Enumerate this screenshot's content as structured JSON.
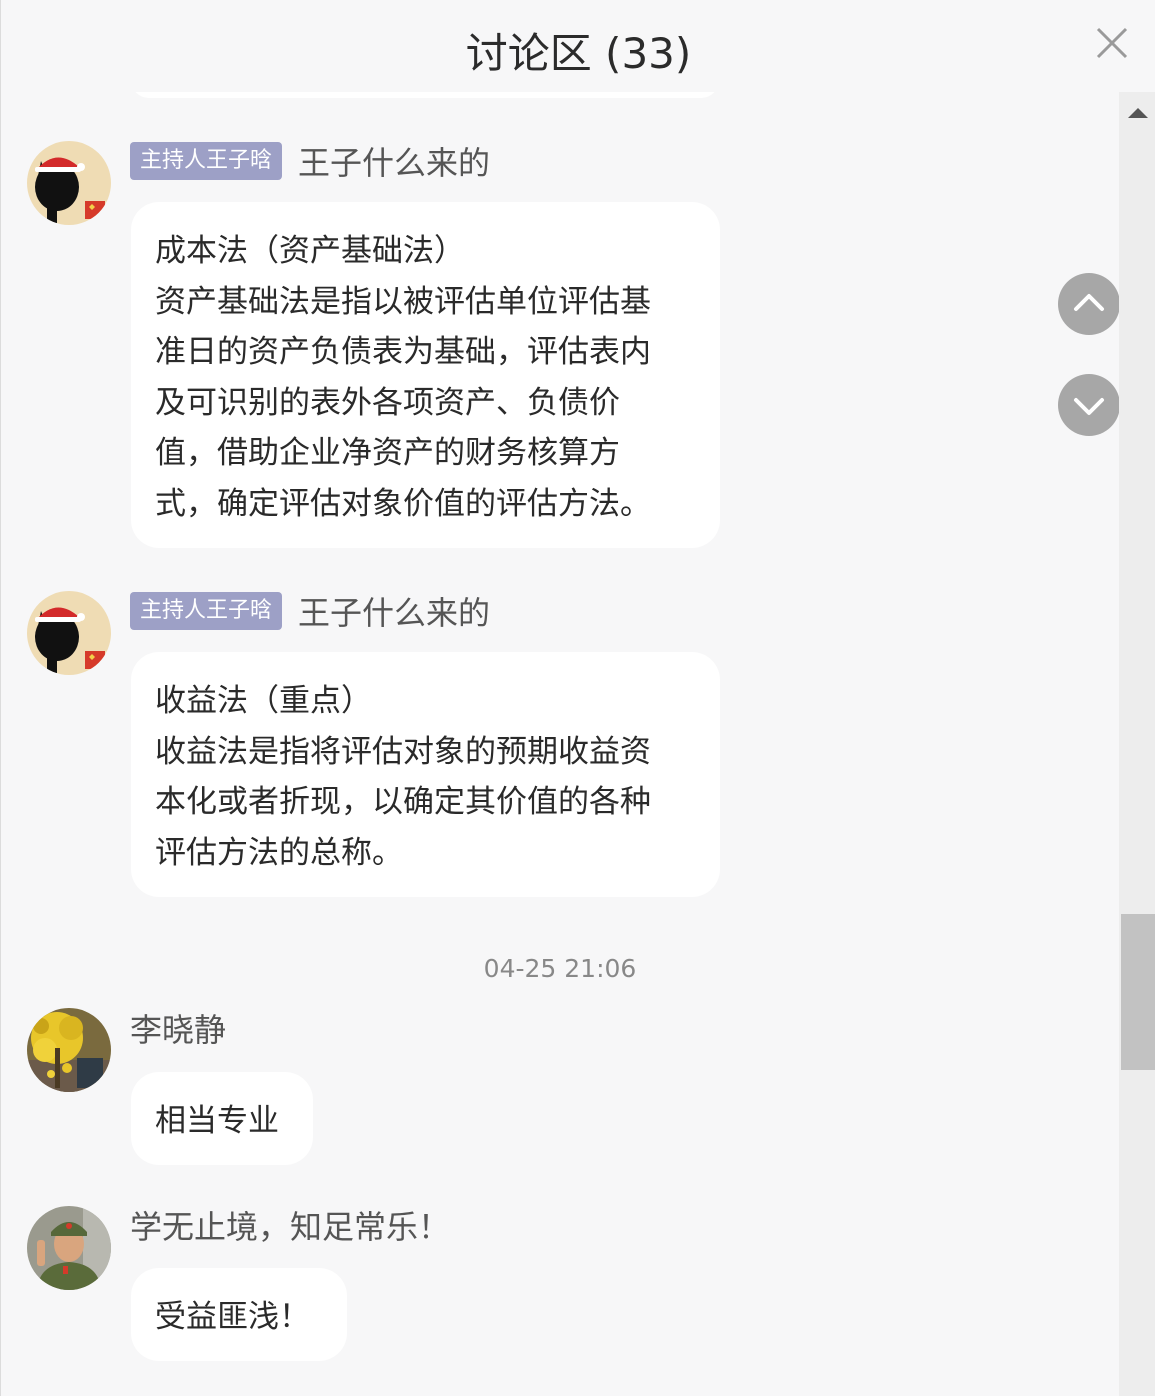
{
  "header": {
    "title": "讨论区 (33)"
  },
  "messages": [
    {
      "badge": "主持人王子晗",
      "name": "王子什么来的",
      "avatar": "cat-santa-avatar",
      "lines": [
        "成本法（资产基础法）",
        "资产基础法是指以被评估单位评估基",
        "准日的资产负债表为基础，评估表内",
        "及可识别的表外各项资产、负债价",
        "值，借助企业净资产的财务核算方",
        "式，确定评估对象价值的评估方法。"
      ]
    },
    {
      "badge": "主持人王子晗",
      "name": "王子什么来的",
      "avatar": "cat-santa-avatar",
      "lines": [
        "收益法（重点）",
        "收益法是指将评估对象的预期收益资",
        "本化或者折现，以确定其价值的各种",
        "评估方法的总称。"
      ]
    },
    {
      "name": "李晓静",
      "avatar": "ginkgo-tree-avatar",
      "lines": [
        "相当专业"
      ]
    },
    {
      "name": "学无止境，知足常乐！",
      "avatar": "soldier-portrait-avatar",
      "lines": [
        "受益匪浅！"
      ]
    }
  ],
  "timestamp": "04-25 21:06",
  "icons": {
    "close": "close-icon",
    "up": "chevron-up-icon",
    "down": "chevron-down-icon",
    "scroll_up": "scroll-up-arrow-icon"
  },
  "colors": {
    "badge": "#9da0c6",
    "background": "#f7f7f8",
    "bubble": "#ffffff",
    "nav_button": "#a7a7a7"
  }
}
